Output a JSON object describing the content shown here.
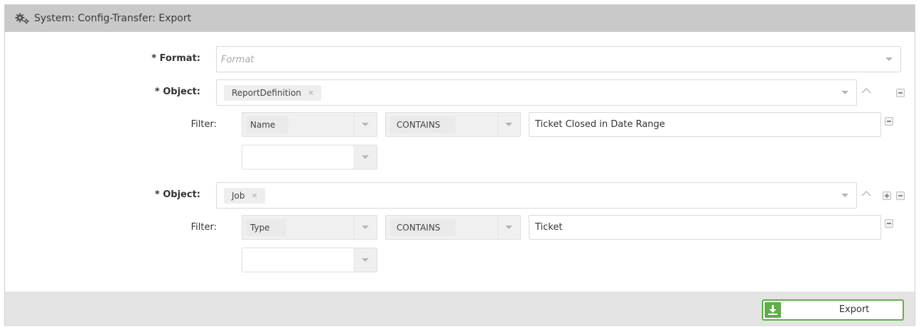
{
  "window": {
    "title": "System: Config-Transfer: Export",
    "icon": "gears-icon"
  },
  "form": {
    "format": {
      "label": "* Format:",
      "placeholder": "Format"
    },
    "objects": [
      {
        "label": "* Object:",
        "tag": "ReportDefinition",
        "filter": {
          "label": "Filter:",
          "field": "Name",
          "operator": "CONTAINS",
          "value": "Ticket Closed in Date Range"
        }
      },
      {
        "label": "* Object:",
        "tag": "Job",
        "filter": {
          "label": "Filter:",
          "field": "Type",
          "operator": "CONTAINS",
          "value": "Ticket"
        }
      }
    ]
  },
  "tag_remove_glyph": "×",
  "footer": {
    "export_label": "Export"
  },
  "colors": {
    "titlebar": "#c9c9c9",
    "footer": "#e4e4e4",
    "export_accent": "#5fae4a"
  }
}
